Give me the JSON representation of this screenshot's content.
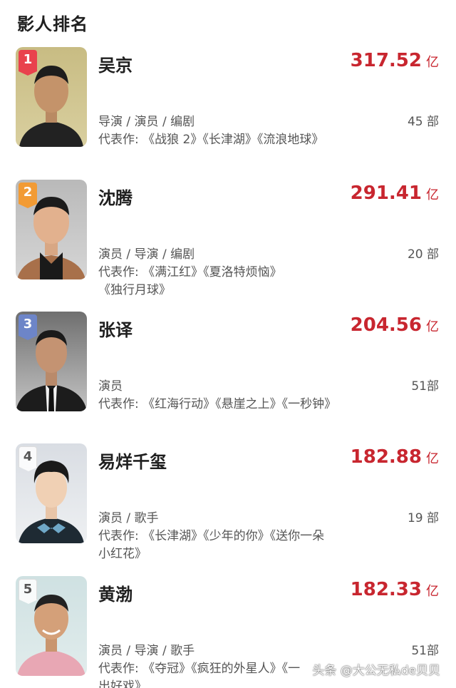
{
  "header": {
    "title": "影人排名"
  },
  "people": [
    {
      "rank": "1",
      "name": "吴京",
      "box_office": "317.52",
      "unit": "亿",
      "roles": "导演 / 演员 / 编剧",
      "count": "45 部",
      "works_line1": "代表作: 《战狼 2》《长津湖》《流浪地球》",
      "works_line2": ""
    },
    {
      "rank": "2",
      "name": "沈腾",
      "box_office": "291.41",
      "unit": "亿",
      "roles": "演员 / 导演 / 编剧",
      "count": "20 部",
      "works_line1": "代表作: 《满江红》《夏洛特烦恼》",
      "works_line2": "《独行月球》"
    },
    {
      "rank": "3",
      "name": "张译",
      "box_office": "204.56",
      "unit": "亿",
      "roles": "演员",
      "count": "51部",
      "works_line1": "代表作: 《红海行动》《悬崖之上》《一秒钟》",
      "works_line2": ""
    },
    {
      "rank": "4",
      "name": "易烊千玺",
      "box_office": "182.88",
      "unit": "亿",
      "roles": "演员 / 歌手",
      "count": "19 部",
      "works_line1": "代表作: 《长津湖》《少年的你》《送你一朵",
      "works_line2": "小红花》"
    },
    {
      "rank": "5",
      "name": "黄渤",
      "box_office": "182.33",
      "unit": "亿",
      "roles": "演员 / 导演 / 歌手",
      "count": "51部",
      "works_line1": "代表作: 《夺冠》《疯狂的外星人》《一",
      "works_line2": "出好戏》"
    }
  ],
  "watermark": "头条 @大公无私de贝贝",
  "colors": {
    "box_office": "#c8262f",
    "rank1": "#e9424d",
    "rank2": "#f29b34",
    "rank3": "#6d85c8"
  }
}
